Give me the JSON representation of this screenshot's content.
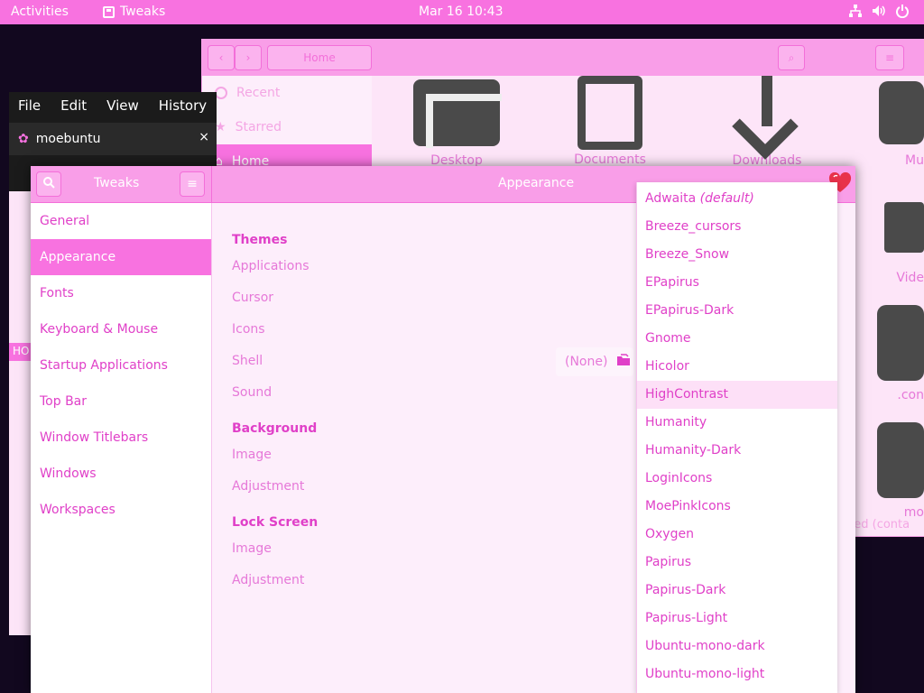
{
  "topbar": {
    "activities": "Activities",
    "app_name": "Tweaks",
    "clock": "Mar 16  10:43"
  },
  "files": {
    "location": "Home",
    "sidebar": [
      "Recent",
      "Starred",
      "Home"
    ],
    "items": [
      "Desktop",
      "Documents",
      "Downloads",
      "Mu",
      "Vide",
      ".con",
      "mo"
    ],
    "status": "cted (conta"
  },
  "terminal": {
    "menu": [
      "File",
      "Edit",
      "View",
      "History"
    ],
    "tab_title": "moebuntu",
    "holiday_tag": "HO"
  },
  "tweaks": {
    "sidebar_title": "Tweaks",
    "panel_title": "Appearance",
    "sidebar_items": [
      "General",
      "Appearance",
      "Fonts",
      "Keyboard & Mouse",
      "Startup Applications",
      "Top Bar",
      "Window Titlebars",
      "Windows",
      "Workspaces"
    ],
    "sections": {
      "themes": "Themes",
      "themes_rows": [
        "Applications",
        "Cursor",
        "Icons",
        "Shell",
        "Sound"
      ],
      "background": "Background",
      "background_rows": [
        "Image",
        "Adjustment"
      ],
      "lock": "Lock Screen",
      "lock_rows": [
        "Image",
        "Adjustment"
      ]
    },
    "shell_value": "(None)"
  },
  "popup": {
    "first": "Adwaita",
    "first_suffix": "(default)",
    "options": [
      "Breeze_cursors",
      "Breeze_Snow",
      "EPapirus",
      "EPapirus-Dark",
      "Gnome",
      "Hicolor",
      "HighContrast",
      "Humanity",
      "Humanity-Dark",
      "LoginIcons",
      "MoePinkIcons",
      "Oxygen",
      "Papirus",
      "Papirus-Dark",
      "Papirus-Light",
      "Ubuntu-mono-dark",
      "Ubuntu-mono-light"
    ],
    "highlighted": "HighContrast"
  },
  "colors": {
    "accent": "#f872e0",
    "text": "#e040c8",
    "background": "#12081f"
  }
}
